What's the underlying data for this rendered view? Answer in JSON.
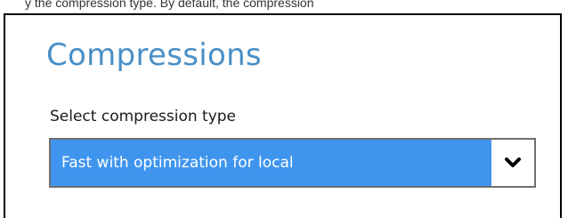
{
  "caption": {
    "text": "y the compression type. By default, the compression"
  },
  "panel": {
    "title": "Compressions",
    "field_label": "Select compression type",
    "select": {
      "selected_value": "Fast with optimization for local",
      "arrow_icon": "chevron-down-icon"
    }
  },
  "colors": {
    "title": "#4a8fc6",
    "select_highlight": "#3f95ee",
    "select_text": "#ffffff",
    "select_border": "#6f6f6f",
    "panel_border": "#000000"
  }
}
